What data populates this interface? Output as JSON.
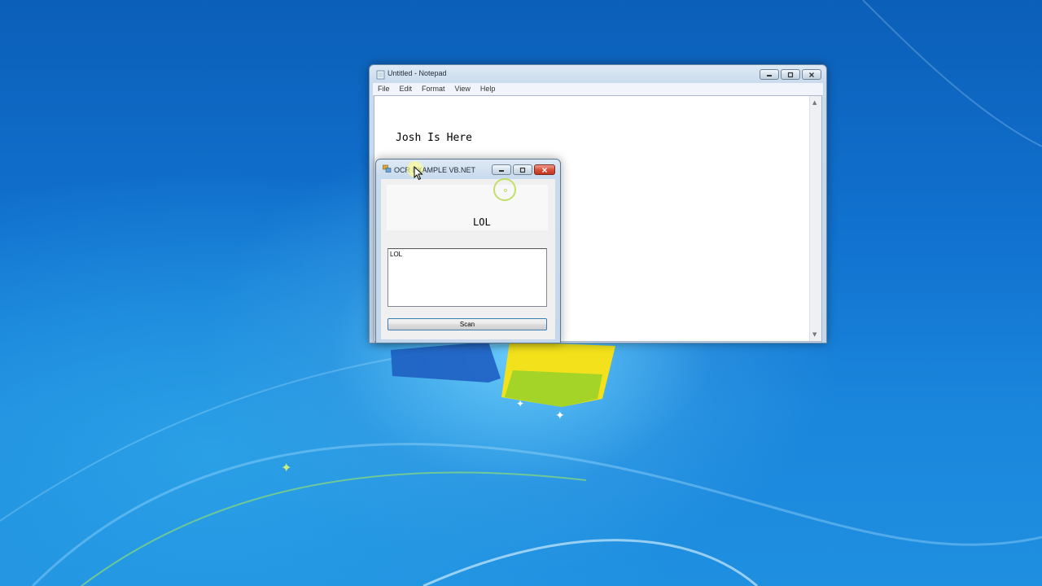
{
  "notepad": {
    "title": "Untitled - Notepad",
    "menu": [
      "File",
      "Edit",
      "Format",
      "View",
      "Help"
    ],
    "content": "Josh Is Here"
  },
  "ocr_app": {
    "title": "OCR EXAMPLE VB.NET",
    "picture_text": "LOL",
    "result_text": "LOL",
    "scan_label": "Scan"
  },
  "icons": {
    "minimize": "minimize-icon",
    "maximize": "maximize-icon",
    "close": "close-icon",
    "notepad_app": "notepad-icon",
    "winforms_app": "app-icon",
    "cursor": "mouse-cursor-icon"
  },
  "colors": {
    "desktop": "#1172cf",
    "close_button": "#d9533c",
    "scan_border": "#3c7fb1"
  }
}
